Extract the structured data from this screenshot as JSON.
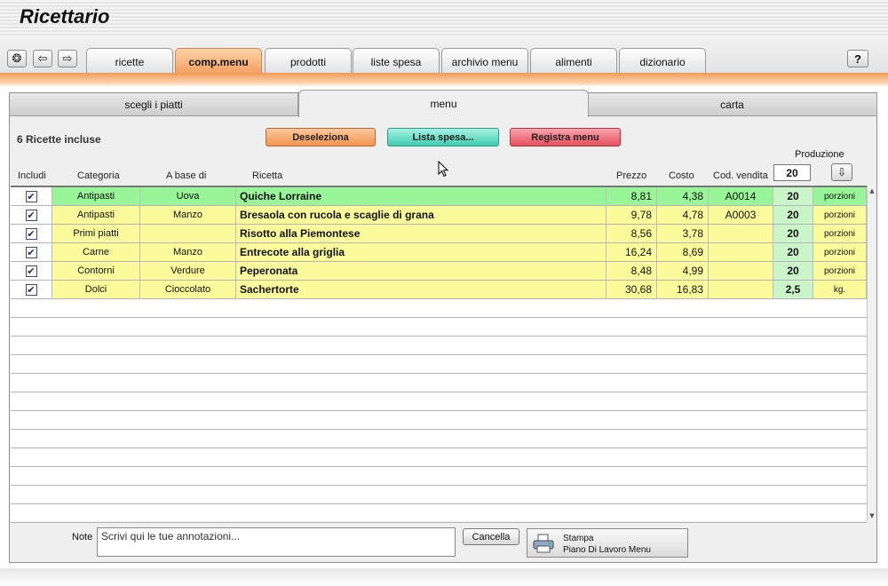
{
  "app": {
    "title": "Ricettario"
  },
  "nav": {
    "home_icon": "gear-icon",
    "back_icon": "arrow-left-icon",
    "forward_icon": "arrow-right-icon",
    "help_label": "?"
  },
  "main_tabs": [
    {
      "label": "ricette",
      "active": false
    },
    {
      "label": "comp.menu",
      "active": true
    },
    {
      "label": "prodotti",
      "active": false
    },
    {
      "label": "liste spesa",
      "active": false
    },
    {
      "label": "archivio menu",
      "active": false
    },
    {
      "label": "alimenti",
      "active": false
    },
    {
      "label": "dizionario",
      "active": false
    }
  ],
  "sub_tabs": [
    {
      "label": "scegli i piatti",
      "active": false
    },
    {
      "label": "menu",
      "active": true
    },
    {
      "label": "carta",
      "active": false
    }
  ],
  "summary": {
    "included": "6 Ricette incluse"
  },
  "buttons": {
    "deselect": "Deseleziona",
    "shopping_list": "Lista spesa...",
    "save_menu": "Registra menu"
  },
  "production": {
    "label": "Produzione",
    "value": "20"
  },
  "columns": {
    "include": "Includi",
    "category": "Categoria",
    "base": "A base di",
    "recipe": "Ricetta",
    "price": "Prezzo",
    "cost": "Costo",
    "code": "Cod. vendita"
  },
  "rows": [
    {
      "checked": true,
      "category": "Antipasti",
      "base": "Uova",
      "recipe": "Quiche Lorraine",
      "price": "8,81",
      "cost": "4,38",
      "code": "A0014",
      "qty": "20",
      "unit": "porzioni",
      "color": "#98f598"
    },
    {
      "checked": true,
      "category": "Antipasti",
      "base": "Manzo",
      "recipe": "Bresaola con rucola e scaglie di grana",
      "price": "9,78",
      "cost": "4,78",
      "code": "A0003",
      "qty": "20",
      "unit": "porzioni",
      "color": "#fbfb9c"
    },
    {
      "checked": true,
      "category": "Primi piatti",
      "base": "",
      "recipe": "Risotto alla Piemontese",
      "price": "8,56",
      "cost": "3,78",
      "code": "",
      "qty": "20",
      "unit": "porzioni",
      "color": "#fbfb9c"
    },
    {
      "checked": true,
      "category": "Carne",
      "base": "Manzo",
      "recipe": "Entrecote alla griglia",
      "price": "16,24",
      "cost": "8,69",
      "code": "",
      "qty": "20",
      "unit": "porzioni",
      "color": "#fbfb9c"
    },
    {
      "checked": true,
      "category": "Contorni",
      "base": "Verdure",
      "recipe": "Peperonata",
      "price": "8,48",
      "cost": "4,99",
      "code": "",
      "qty": "20",
      "unit": "porzioni",
      "color": "#fbfb9c"
    },
    {
      "checked": true,
      "category": "Dolci",
      "base": "Cioccolato",
      "recipe": "Sachertorte",
      "price": "30,68",
      "cost": "16,83",
      "code": "",
      "qty": "2,5",
      "unit": "kg.",
      "color": "#fbfb9c"
    }
  ],
  "notes": {
    "label": "Note",
    "placeholder": "Scrivi qui le tue annotazioni...",
    "cancel": "Cancella"
  },
  "print": {
    "line1": "Stampa",
    "line2": "Piano Di Lavoro Menu"
  }
}
